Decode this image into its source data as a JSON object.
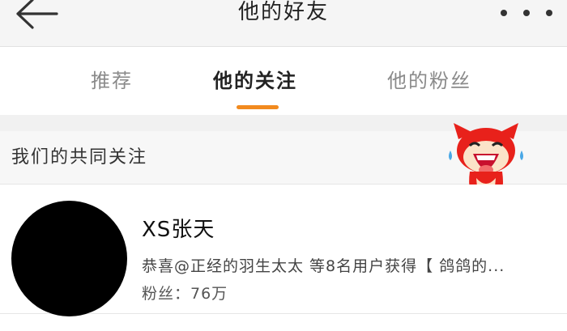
{
  "header": {
    "title": "他的好友",
    "back_icon": "arrow-left-icon",
    "more_icon": "more-dots-icon"
  },
  "tabs": [
    {
      "label": "推荐",
      "active": false
    },
    {
      "label": "他的关注",
      "active": true
    },
    {
      "label": "他的粉丝",
      "active": false
    }
  ],
  "accent_color": "#f28a1e",
  "section": {
    "title": "我们的共同关注",
    "mascot_icon": "red-fox-mascot-icon"
  },
  "user": {
    "name": "XS张天",
    "description": "恭喜@正经的羽生太太 等8名用户获得【 鸽鸽的...",
    "fans": "粉丝：76万"
  }
}
